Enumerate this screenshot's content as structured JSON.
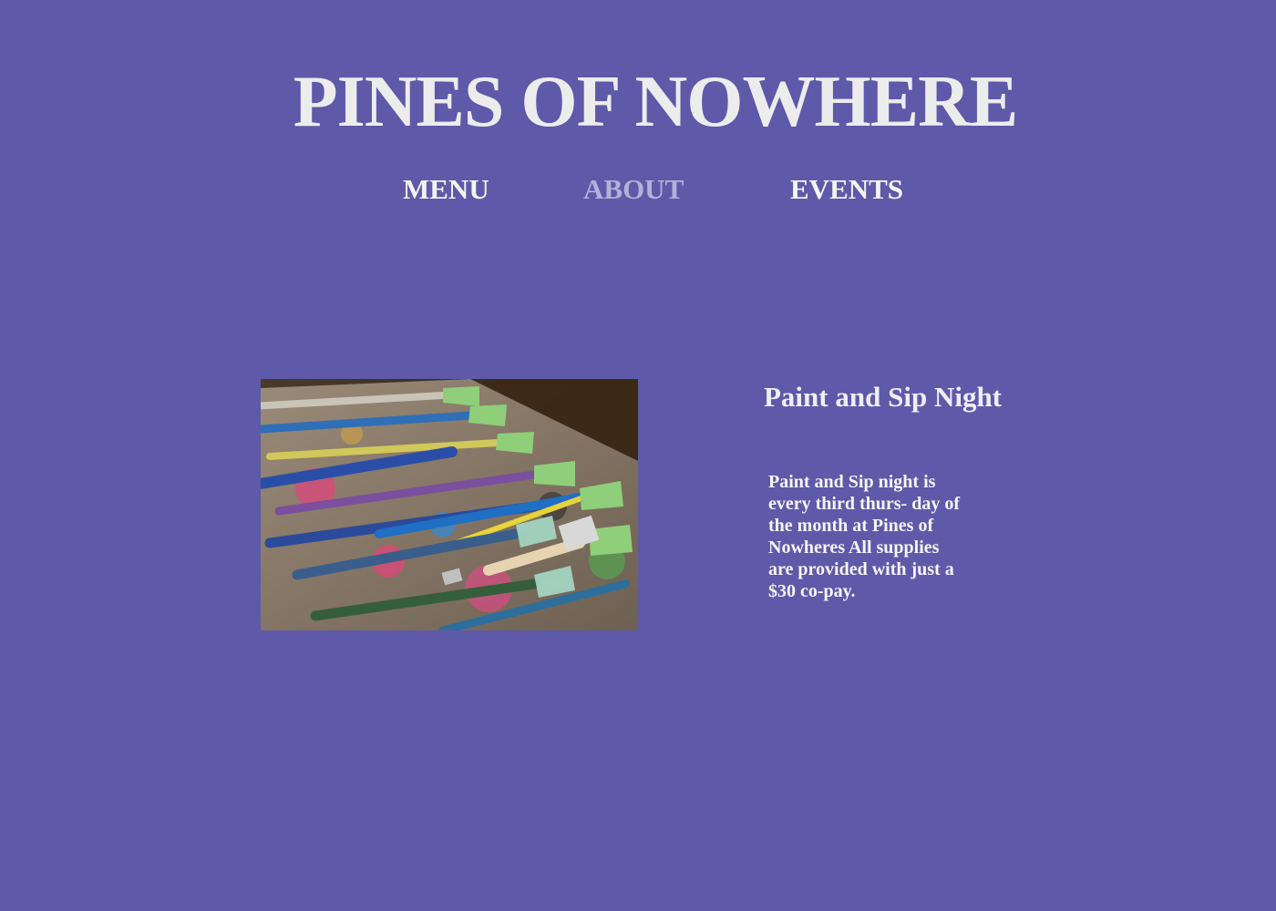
{
  "header": {
    "site_title": "PINES OF NOWHERE"
  },
  "nav": {
    "menu": "MENU",
    "about": "ABOUT",
    "events": "EVENTS"
  },
  "event": {
    "image_icon": "paint-brushes-photo",
    "title": "Paint and Sip Night",
    "description": "Paint and Sip night is every third thurs- day of the month at Pines of Nowheres All supplies are provided with just a $30 co-pay."
  },
  "colors": {
    "background": "#5e59a8",
    "text": "#ececec",
    "nav_active": "#b3b1d9"
  }
}
